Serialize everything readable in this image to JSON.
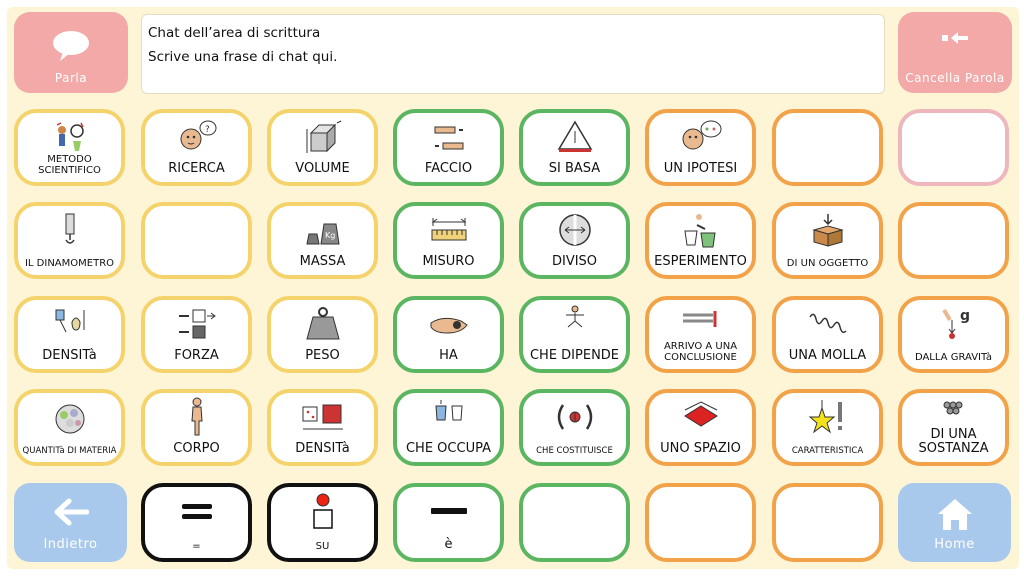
{
  "top": {
    "speak_label": "Parla",
    "clear_label": "Cancella Parola",
    "message_title": "Chat dell’area di scrittura",
    "message_placeholder": "Scrive una frase di chat qui."
  },
  "colors": {
    "background": "#fdf5d6",
    "yellow_border": "#f5d36c",
    "green_border": "#5bb561",
    "orange_border": "#f2a249",
    "pink_button": "#f2a9a8",
    "blue_button": "#a9c9ec"
  },
  "grid": {
    "row1": [
      {
        "label": "METODO SCIENTIFICO",
        "icon": "scientist-icon",
        "color": "yellow"
      },
      {
        "label": "RICERCA",
        "icon": "thinking-face-icon",
        "color": "yellow"
      },
      {
        "label": "VOLUME",
        "icon": "cube-volume-icon",
        "color": "yellow"
      },
      {
        "label": "FACCIO",
        "icon": "hands-doing-icon",
        "color": "green"
      },
      {
        "label": "SI BASA",
        "icon": "triangle-base-icon",
        "color": "green"
      },
      {
        "label": "UN IPOTESI",
        "icon": "thinking-face-icon",
        "color": "orange"
      },
      {
        "label": "",
        "icon": "",
        "color": "orange"
      },
      {
        "label": "",
        "icon": "",
        "color": "pink"
      }
    ],
    "row2": [
      {
        "label": "IL DINAMOMETRO",
        "icon": "dynamometer-icon",
        "color": "yellow"
      },
      {
        "label": "",
        "icon": "",
        "color": "yellow"
      },
      {
        "label": "MASSA",
        "icon": "weights-icon",
        "color": "yellow"
      },
      {
        "label": "MISURO",
        "icon": "ruler-icon",
        "color": "green"
      },
      {
        "label": "DIVISO",
        "icon": "divided-circle-icon",
        "color": "green"
      },
      {
        "label": "ESPERIMENTO",
        "icon": "experiment-icon",
        "color": "orange"
      },
      {
        "label": "DI UN OGGETTO",
        "icon": "box-icon",
        "color": "orange"
      },
      {
        "label": "",
        "icon": "",
        "color": "orange"
      }
    ],
    "row3": [
      {
        "label": "DENSITà",
        "icon": "drops-icon",
        "color": "yellow"
      },
      {
        "label": "FORZA",
        "icon": "push-force-icon",
        "color": "yellow"
      },
      {
        "label": "PESO",
        "icon": "weight-icon",
        "color": "yellow"
      },
      {
        "label": "HA",
        "icon": "hand-holding-icon",
        "color": "green"
      },
      {
        "label": "CHE DIPENDE",
        "icon": "depends-icon",
        "color": "green"
      },
      {
        "label": "ARRIVO A UNA CONCLUSIONE",
        "icon": "arrival-icon",
        "color": "orange"
      },
      {
        "label": "UNA MOLLA",
        "icon": "spring-icon",
        "color": "orange"
      },
      {
        "label": "DALLA GRAVITà",
        "icon": "gravity-icon",
        "color": "orange"
      }
    ],
    "row4": [
      {
        "label": "QUANTITà DI MATERIA",
        "icon": "matter-icon",
        "color": "yellow"
      },
      {
        "label": "CORPO",
        "icon": "body-icon",
        "color": "yellow"
      },
      {
        "label": "DENSITà",
        "icon": "density-cubes-icon",
        "color": "yellow"
      },
      {
        "label": "CHE OCCUPA",
        "icon": "occupy-icon",
        "color": "green"
      },
      {
        "label": "CHE COSTITUISCE",
        "icon": "constitutes-icon",
        "color": "green"
      },
      {
        "label": "UNO SPAZIO",
        "icon": "space-icon",
        "color": "orange"
      },
      {
        "label": "CARATTERISTICA",
        "icon": "star-exclamation-icon",
        "color": "orange"
      },
      {
        "label": "DI UNA SOSTANZA",
        "icon": "substance-icon",
        "color": "orange"
      }
    ],
    "row5": [
      {
        "label": "=",
        "icon": "equals-icon",
        "color": "black"
      },
      {
        "label": "SU",
        "icon": "on-top-icon",
        "color": "black"
      },
      {
        "label": "è",
        "icon": "minus-icon",
        "color": "green"
      },
      {
        "label": "",
        "icon": "",
        "color": "green"
      },
      {
        "label": "",
        "icon": "",
        "color": "orange"
      },
      {
        "label": "",
        "icon": "",
        "color": "orange"
      }
    ]
  },
  "nav": {
    "back_label": "Indietro",
    "home_label": "Home"
  }
}
